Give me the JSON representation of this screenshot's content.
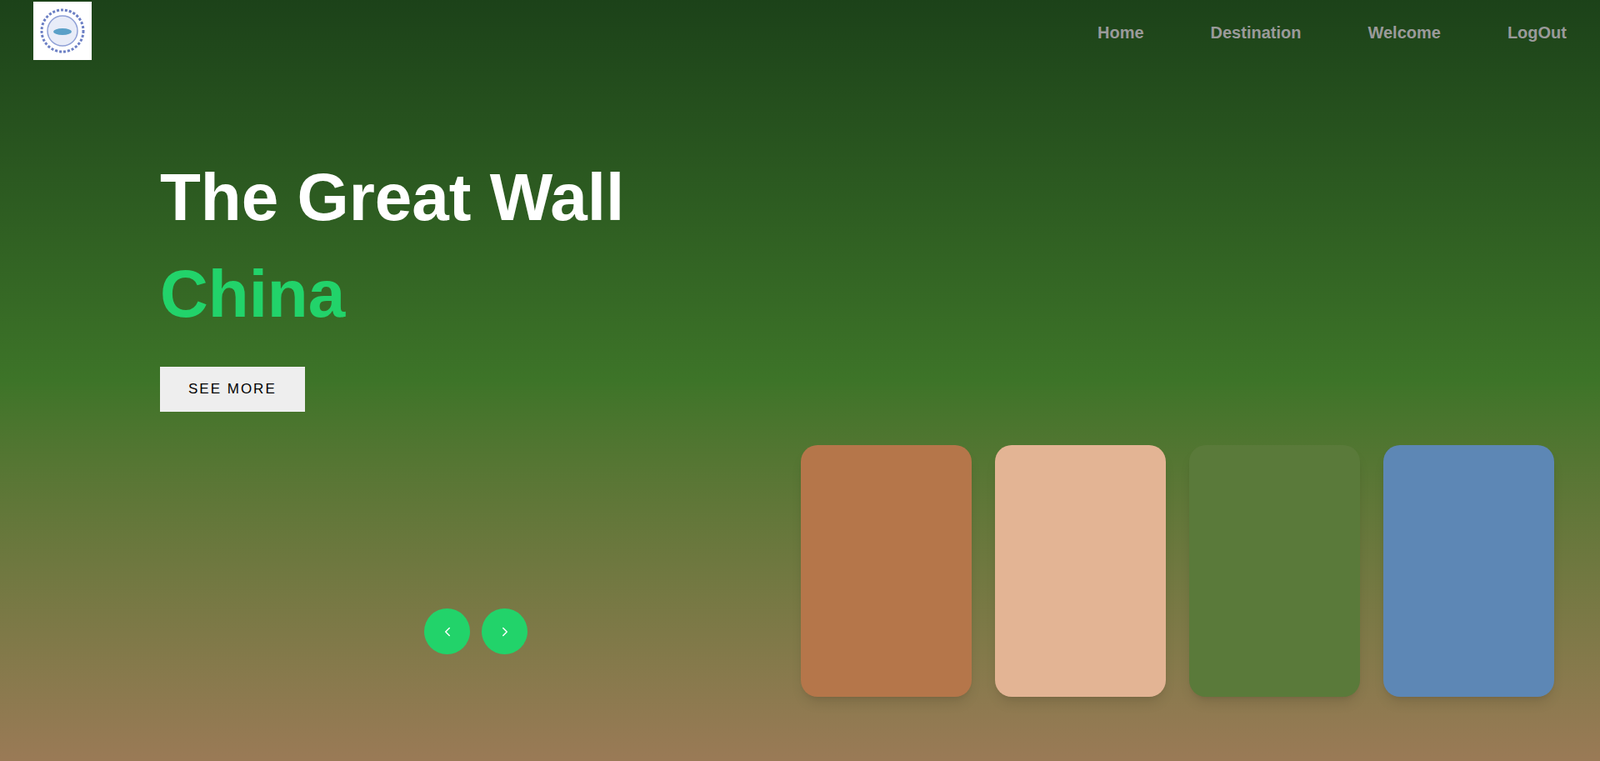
{
  "nav": {
    "items": [
      {
        "label": "Home"
      },
      {
        "label": "Destination"
      },
      {
        "label": "Welcome"
      },
      {
        "label": "LogOut"
      }
    ]
  },
  "hero": {
    "title": "The Great Wall",
    "subtitle": "China",
    "button": "SEE MORE"
  },
  "cards": [
    {
      "color": "#b5764a"
    },
    {
      "color": "#e3b494"
    },
    {
      "color": "#5a7a3a"
    },
    {
      "color": "#5d87b5"
    }
  ]
}
